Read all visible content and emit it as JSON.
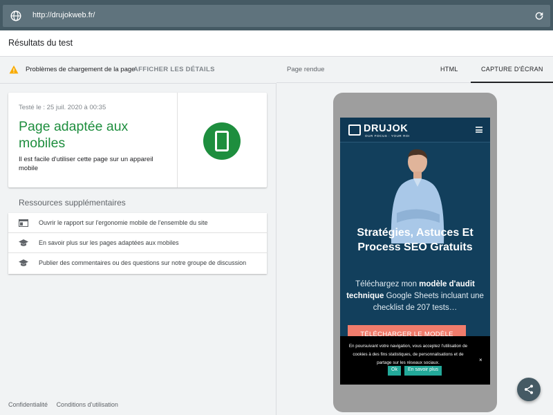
{
  "urlbar": {
    "url": "http://drujokweb.fr/"
  },
  "header": {
    "title": "Résultats du test"
  },
  "warning": {
    "text": "Problèmes de chargement de la page",
    "link": "AFFICHER LES DÉTAILS"
  },
  "result": {
    "date": "Testé le : 25 juil. 2020 à 00:35",
    "verdict": "Page adaptée aux mobiles",
    "description": "Il est facile d'utiliser cette page sur un appareil mobile",
    "color": "#1e8e3e"
  },
  "resources": {
    "title": "Ressources supplémentaires",
    "items": [
      {
        "icon": "browser-window-icon",
        "label": "Ouvrir le rapport sur l'ergonomie mobile de l'ensemble du site"
      },
      {
        "icon": "graduation-cap-icon",
        "label": "En savoir plus sur les pages adaptées aux mobiles"
      },
      {
        "icon": "graduation-cap-icon",
        "label": "Publier des commentaires ou des questions sur notre groupe de discussion"
      }
    ]
  },
  "footer": {
    "privacy": "Confidentialité",
    "terms": "Conditions d'utilisation"
  },
  "right": {
    "rendered_label": "Page rendue",
    "tabs": [
      "HTML",
      "CAPTURE D'ÉCRAN"
    ],
    "active_tab": "CAPTURE D'ÉCRAN"
  },
  "screenshot": {
    "logo": "DRUJOK",
    "tagline": "OUR FOCUS : YOUR ROI",
    "headline": "Stratégies, Astuces Et Process SEO Gratuits",
    "sub_pre": "Téléchargez mon ",
    "sub_bold1": "modèle d'audit technique",
    "sub_mid": " Google Sheets incluant une checklist de 207 tests…",
    "cta": "TÉLÉCHARGER LE MODÈLE",
    "cookie_text": "En poursuivant votre navigation, vous acceptez l'utilisation de cookies à des fins statistiques, de personnalisations et de partage sur les réseaux sociaux.",
    "cookie_ok": "Ok",
    "cookie_more": "En savoir plus",
    "cookie_close": "×",
    "bg_color": "#123f5c"
  }
}
